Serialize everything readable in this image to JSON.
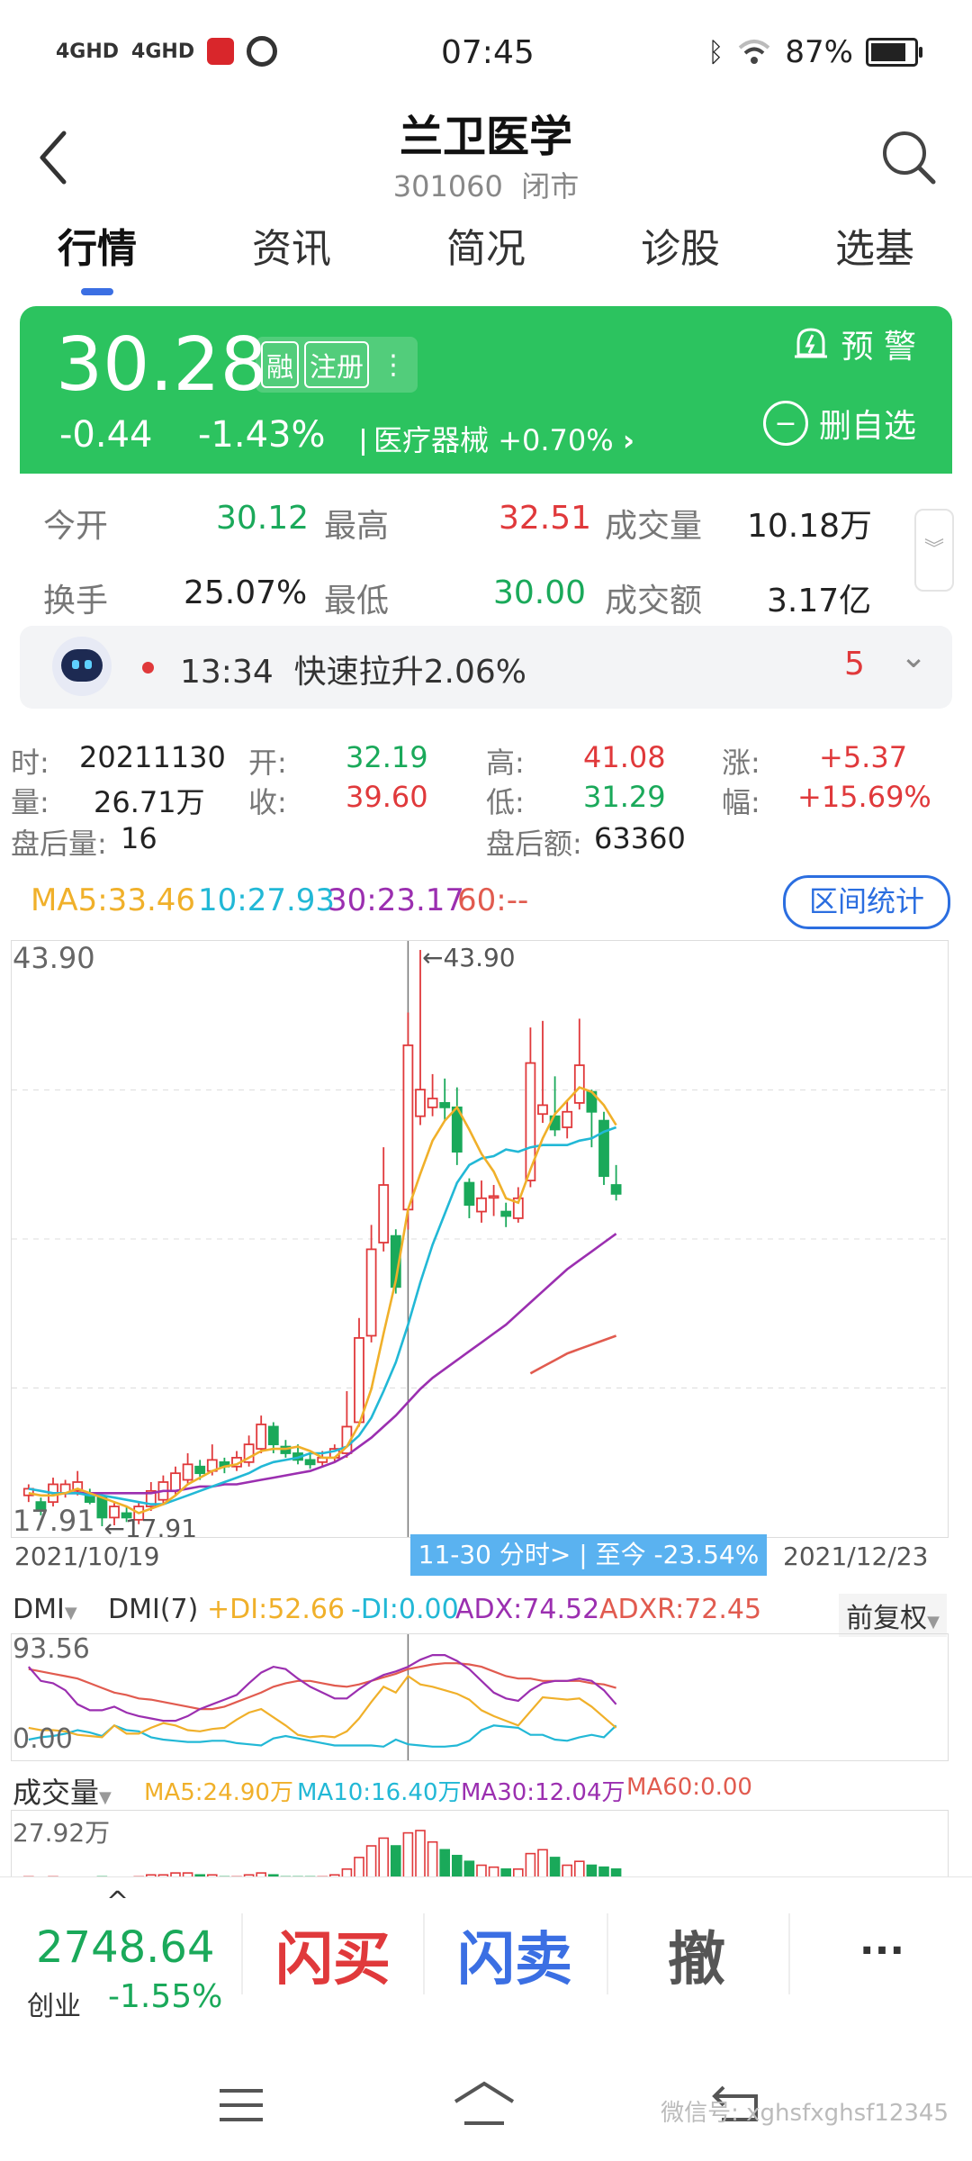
{
  "status": {
    "net1": "4GHD",
    "net2": "4GHD",
    "time": "07:45",
    "battery": "87%",
    "battery_level": 0.87
  },
  "header": {
    "title": "兰卫医学",
    "code": "301060",
    "state": "闭市"
  },
  "tabs": [
    {
      "label": "行情",
      "active": true
    },
    {
      "label": "资讯"
    },
    {
      "label": "简况"
    },
    {
      "label": "诊股"
    },
    {
      "label": "选基"
    }
  ],
  "banner": {
    "price": "30.28",
    "badge_margin": "融",
    "badge_reg": "注册",
    "change": "-0.44",
    "change_pct": "-1.43%",
    "sector": "医疗器械",
    "sector_chg": "+0.70%",
    "alert": "预 警",
    "del_fav": "删自选"
  },
  "quote": {
    "open_label": "今开",
    "open": "30.12",
    "high_label": "最高",
    "high": "32.51",
    "vol_label": "成交量",
    "vol": "10.18万",
    "turn_label": "换手",
    "turn": "25.07%",
    "low_label": "最低",
    "low": "30.00",
    "amt_label": "成交额",
    "amt": "3.17亿"
  },
  "news": {
    "time": "13:34",
    "text": "快速拉升2.06%",
    "count": "5"
  },
  "kinfo": {
    "time_label": "时:",
    "time": "20211130",
    "open_label": "开:",
    "open": "32.19",
    "high_label": "高:",
    "high": "41.08",
    "rise_label": "涨:",
    "rise": "+5.37",
    "vol_label": "量:",
    "vol": "26.71万",
    "close_label": "收:",
    "close": "39.60",
    "low_label": "低:",
    "low": "31.29",
    "amp_label": "幅:",
    "amp": "+15.69%",
    "ah_vol_label": "盘后量:",
    "ah_vol": "16",
    "ah_amt_label": "盘后额:",
    "ah_amt": "63360"
  },
  "ma": {
    "ma5": "MA5:33.46",
    "ma10": "10:27.93",
    "ma30": "30:23.17",
    "ma60": "60:--",
    "range_btn": "区间统计"
  },
  "colors": {
    "up": "#e0393b",
    "down": "#1aa95a",
    "ma5": "#f0b02a",
    "ma10": "#22b8d6",
    "ma30": "#9b2fb0",
    "ma60": "#e15b4f"
  },
  "chart_data": {
    "type": "candlestick",
    "ymax_label": "43.90",
    "ymin_label": "17.91",
    "high_marker": "←43.90",
    "low_marker": "←17.91",
    "ylim": [
      17.91,
      43.9
    ],
    "x_start": "2021/10/19",
    "x_end": "2021/12/23",
    "overlay": "11-30 分时> | 至今 -23.54%",
    "candles": [
      {
        "o": 19.3,
        "c": 19.6,
        "h": 19.8,
        "l": 19.0
      },
      {
        "o": 19.0,
        "c": 18.6,
        "h": 19.2,
        "l": 18.4
      },
      {
        "o": 19.0,
        "c": 19.8,
        "h": 20.1,
        "l": 18.8
      },
      {
        "o": 19.4,
        "c": 19.8,
        "h": 20.0,
        "l": 19.2
      },
      {
        "o": 19.5,
        "c": 19.9,
        "h": 20.4,
        "l": 19.3
      },
      {
        "o": 19.4,
        "c": 19.0,
        "h": 19.6,
        "l": 18.9
      },
      {
        "o": 19.2,
        "c": 18.3,
        "h": 19.3,
        "l": 17.91
      },
      {
        "o": 18.3,
        "c": 18.8,
        "h": 19.0,
        "l": 17.95
      },
      {
        "o": 18.5,
        "c": 18.3,
        "h": 18.8,
        "l": 18.1
      },
      {
        "o": 18.2,
        "c": 18.8,
        "h": 19.0,
        "l": 18.0
      },
      {
        "o": 18.8,
        "c": 19.5,
        "h": 19.9,
        "l": 18.6
      },
      {
        "o": 19.1,
        "c": 19.9,
        "h": 20.2,
        "l": 18.9
      },
      {
        "o": 19.5,
        "c": 20.3,
        "h": 20.6,
        "l": 19.3
      },
      {
        "o": 20.0,
        "c": 20.7,
        "h": 21.2,
        "l": 19.8
      },
      {
        "o": 20.6,
        "c": 20.3,
        "h": 20.9,
        "l": 20.0
      },
      {
        "o": 20.4,
        "c": 20.9,
        "h": 21.6,
        "l": 20.2
      },
      {
        "o": 20.8,
        "c": 20.6,
        "h": 21.0,
        "l": 20.3
      },
      {
        "o": 20.6,
        "c": 21.0,
        "h": 21.3,
        "l": 20.4
      },
      {
        "o": 20.8,
        "c": 21.6,
        "h": 22.0,
        "l": 20.6
      },
      {
        "o": 21.4,
        "c": 22.5,
        "h": 22.9,
        "l": 21.2
      },
      {
        "o": 22.4,
        "c": 21.6,
        "h": 22.6,
        "l": 21.2
      },
      {
        "o": 21.5,
        "c": 21.2,
        "h": 21.8,
        "l": 21.0
      },
      {
        "o": 21.2,
        "c": 20.9,
        "h": 21.6,
        "l": 20.7
      },
      {
        "o": 20.9,
        "c": 20.7,
        "h": 21.2,
        "l": 20.5
      },
      {
        "o": 20.8,
        "c": 21.0,
        "h": 21.3,
        "l": 20.6
      },
      {
        "o": 21.0,
        "c": 21.4,
        "h": 21.6,
        "l": 20.8
      },
      {
        "o": 21.2,
        "c": 22.4,
        "h": 24.0,
        "l": 21.0
      },
      {
        "o": 22.6,
        "c": 26.4,
        "h": 27.3,
        "l": 22.4
      },
      {
        "o": 26.5,
        "c": 30.4,
        "h": 31.5,
        "l": 26.2
      },
      {
        "o": 30.7,
        "c": 33.3,
        "h": 35.0,
        "l": 30.3
      },
      {
        "o": 31.0,
        "c": 28.7,
        "h": 31.3,
        "l": 28.4
      },
      {
        "o": 32.19,
        "c": 39.6,
        "h": 41.08,
        "l": 31.29
      },
      {
        "o": 36.4,
        "c": 37.6,
        "h": 43.9,
        "l": 36.0
      },
      {
        "o": 36.8,
        "c": 37.2,
        "h": 38.3,
        "l": 36.4
      },
      {
        "o": 37.0,
        "c": 36.8,
        "h": 38.1,
        "l": 36.2
      },
      {
        "o": 36.8,
        "c": 34.8,
        "h": 37.7,
        "l": 34.2
      },
      {
        "o": 33.4,
        "c": 32.4,
        "h": 33.6,
        "l": 31.8
      },
      {
        "o": 32.1,
        "c": 32.7,
        "h": 33.5,
        "l": 31.6
      },
      {
        "o": 32.8,
        "c": 32.8,
        "h": 33.3,
        "l": 31.9
      },
      {
        "o": 32.1,
        "c": 31.9,
        "h": 32.5,
        "l": 31.4
      },
      {
        "o": 31.8,
        "c": 32.7,
        "h": 33.2,
        "l": 31.6
      },
      {
        "o": 33.5,
        "c": 38.8,
        "h": 40.4,
        "l": 33.2
      },
      {
        "o": 36.5,
        "c": 36.9,
        "h": 40.7,
        "l": 36.1
      },
      {
        "o": 36.4,
        "c": 35.8,
        "h": 38.2,
        "l": 35.5
      },
      {
        "o": 35.9,
        "c": 36.6,
        "h": 37.1,
        "l": 35.4
      },
      {
        "o": 37.0,
        "c": 38.7,
        "h": 40.8,
        "l": 36.7
      },
      {
        "o": 37.5,
        "c": 36.6,
        "h": 37.6,
        "l": 35.0
      },
      {
        "o": 36.2,
        "c": 33.7,
        "h": 36.6,
        "l": 33.3
      },
      {
        "o": 33.3,
        "c": 32.9,
        "h": 34.2,
        "l": 32.6
      }
    ],
    "ma5": [
      19.4,
      19.3,
      19.3,
      19.4,
      19.6,
      19.4,
      19.2,
      19.0,
      18.8,
      18.5,
      18.7,
      18.9,
      19.3,
      19.8,
      20.1,
      20.4,
      20.6,
      20.7,
      21.0,
      21.3,
      21.4,
      21.4,
      21.5,
      21.3,
      21.0,
      21.0,
      21.5,
      22.5,
      24.1,
      26.6,
      29.0,
      32.2,
      33.8,
      35.3,
      36.2,
      36.8,
      35.8,
      34.7,
      33.9,
      32.7,
      32.5,
      34.0,
      35.4,
      36.5,
      37.1,
      37.7,
      37.5,
      36.9,
      36.0
    ],
    "ma10": [
      19.6,
      19.5,
      19.4,
      19.4,
      19.4,
      19.3,
      19.3,
      19.2,
      19.1,
      19.0,
      18.9,
      18.9,
      19.1,
      19.3,
      19.5,
      19.7,
      19.9,
      20.1,
      20.3,
      20.6,
      20.8,
      20.9,
      21.0,
      21.2,
      21.2,
      21.3,
      21.5,
      22.0,
      22.8,
      24.0,
      25.3,
      27.0,
      28.9,
      30.6,
      32.0,
      33.4,
      34.2,
      34.5,
      34.6,
      34.9,
      34.8,
      35.0,
      35.1,
      35.1,
      35.1,
      35.3,
      35.4,
      35.7,
      35.9
    ],
    "ma30": [
      null,
      null,
      19.4,
      19.4,
      19.4,
      19.4,
      19.4,
      19.4,
      19.4,
      19.4,
      19.4,
      19.5,
      19.5,
      19.6,
      19.7,
      19.7,
      19.8,
      19.8,
      19.9,
      20.0,
      20.1,
      20.2,
      20.3,
      20.4,
      20.6,
      20.8,
      21.1,
      21.5,
      21.9,
      22.4,
      22.9,
      23.5,
      24.1,
      24.6,
      25.0,
      25.4,
      25.8,
      26.2,
      26.6,
      27.0,
      27.5,
      28.0,
      28.5,
      29.0,
      29.5,
      29.9,
      30.3,
      30.7,
      31.1
    ],
    "ma60": [
      null,
      null,
      null,
      null,
      null,
      null,
      null,
      null,
      null,
      null,
      null,
      null,
      null,
      null,
      null,
      null,
      null,
      null,
      null,
      null,
      null,
      null,
      null,
      null,
      null,
      null,
      null,
      null,
      null,
      null,
      null,
      null,
      null,
      null,
      null,
      null,
      null,
      null,
      null,
      null,
      null,
      24.8,
      25.1,
      25.4,
      25.7,
      25.9,
      26.1,
      26.3,
      26.5
    ]
  },
  "dmi": {
    "name": "DMI",
    "sel": "DMI(7)",
    "pdi": "+DI:52.66",
    "mdi": "-DI:0.00",
    "adx": "ADX:74.52",
    "adxr": "ADXR:72.45",
    "fq": "前复权",
    "ymax": "93.56",
    "ymin": "0.00",
    "pdi_series": [
      20,
      18,
      18,
      17,
      14,
      13,
      12,
      22,
      15,
      15,
      20,
      24,
      22,
      18,
      17,
      19,
      20,
      27,
      33,
      36,
      29,
      22,
      14,
      12,
      13,
      12,
      17,
      28,
      42,
      55,
      50,
      64,
      57,
      55,
      52,
      49,
      44,
      35,
      30,
      26,
      22,
      34,
      46,
      45,
      44,
      45,
      38,
      29,
      20
    ],
    "mdi_series": [
      10,
      12,
      13,
      15,
      18,
      16,
      13,
      22,
      18,
      17,
      12,
      10,
      9,
      8,
      8,
      9,
      9,
      7,
      6,
      5,
      11,
      13,
      11,
      9,
      7,
      5,
      5,
      5,
      5,
      4,
      10,
      6,
      5,
      4,
      4,
      5,
      9,
      18,
      22,
      21,
      20,
      14,
      14,
      10,
      9,
      12,
      14,
      12,
      22
    ],
    "adx_series": [
      72,
      60,
      58,
      52,
      40,
      35,
      35,
      38,
      33,
      30,
      28,
      26,
      26,
      30,
      36,
      40,
      44,
      48,
      58,
      67,
      72,
      70,
      62,
      55,
      50,
      45,
      45,
      53,
      60,
      65,
      68,
      72,
      78,
      82,
      82,
      77,
      70,
      60,
      50,
      45,
      43,
      52,
      58,
      60,
      60,
      62,
      60,
      52,
      40
    ],
    "adxr_series": [
      70,
      68,
      66,
      64,
      62,
      58,
      54,
      50,
      48,
      45,
      44,
      42,
      40,
      38,
      36,
      36,
      38,
      42,
      46,
      50,
      55,
      58,
      60,
      60,
      58,
      56,
      55,
      57,
      60,
      63,
      66,
      70,
      72,
      74,
      75,
      75,
      74,
      72,
      68,
      64,
      62,
      62,
      60,
      60,
      60,
      60,
      58,
      57,
      54
    ]
  },
  "vol": {
    "label": "成交量",
    "ma5": "MA5:24.90万",
    "ma10": "MA10:16.40万",
    "ma30": "MA30:12.04万",
    "ma60": "MA60:0.00",
    "max": "27.92万"
  },
  "bottom": {
    "index": "2748.64",
    "index_name": "创业",
    "index_chg": "-1.55%",
    "buy": "闪买",
    "sell": "闪卖",
    "cancel": "撤",
    "more": "···"
  },
  "watermark": "微信号: xghsfxghsf12345"
}
